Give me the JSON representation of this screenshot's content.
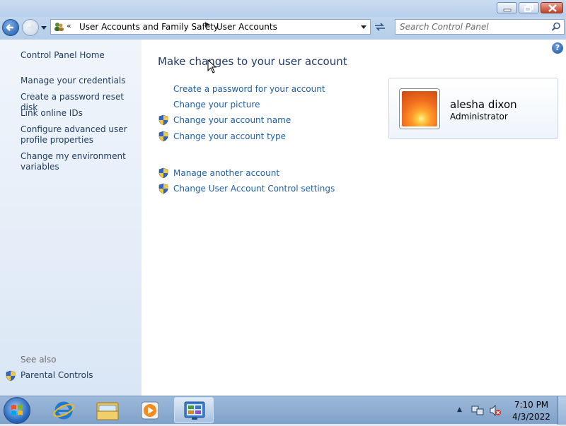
{
  "window": {
    "controls": {
      "minimize": "minimize",
      "maximize": "maximize",
      "close": "close"
    }
  },
  "address_bar": {
    "overflow": "«",
    "breadcrumbs": [
      "User Accounts and Family Safety",
      "User Accounts"
    ],
    "separator": "▶"
  },
  "search": {
    "placeholder": "Search Control Panel"
  },
  "sidebar": {
    "home": "Control Panel Home",
    "links": [
      "Manage your credentials",
      "Create a password reset disk",
      "Link online IDs",
      "Configure advanced user profile properties",
      "Change my environment variables"
    ],
    "see_also_title": "See also",
    "see_also": [
      "Parental Controls"
    ]
  },
  "main": {
    "title": "Make changes to your user account",
    "tasks": [
      {
        "label": "Create a password for your account",
        "shield": false
      },
      {
        "label": "Change your picture",
        "shield": false
      },
      {
        "label": "Change your account name",
        "shield": true
      },
      {
        "label": "Change your account type",
        "shield": true
      }
    ],
    "other_tasks": [
      {
        "label": "Manage another account",
        "shield": true
      },
      {
        "label": "Change User Account Control settings",
        "shield": true
      }
    ],
    "help": "?"
  },
  "user": {
    "name": "alesha dixon",
    "role": "Administrator"
  },
  "taskbar": {
    "apps": [
      "internet-explorer",
      "windows-explorer",
      "windows-media-player",
      "control-panel"
    ],
    "active_app": "control-panel",
    "tray_expand": "▲",
    "clock_time": "7:10 PM",
    "clock_date": "4/3/2022"
  },
  "colors": {
    "link": "#1e5fa8",
    "nav_link": "#1e3a5c",
    "title": "#1e3a6e",
    "see_also": "#6d6d6d"
  }
}
